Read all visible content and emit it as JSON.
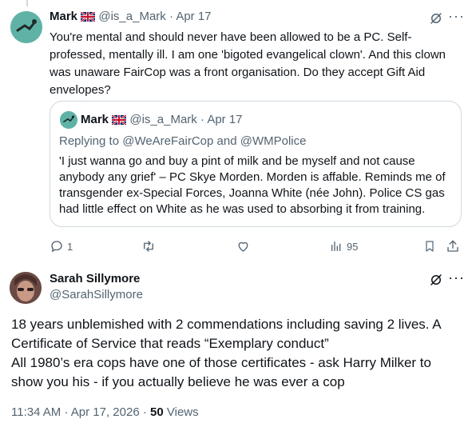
{
  "tweet1": {
    "name": "Mark",
    "handle": "@is_a_Mark",
    "sep": "·",
    "date": "Apr 17",
    "text_lines": [
      "You're mental and should never have been allowed to be a PC. Self-",
      "professed, mentally ill. I am one 'bigoted evangelical clown'. And this clown",
      "was unaware FairCop was a front organisation. Do they accept Gift Aid",
      "envelopes?"
    ]
  },
  "quote": {
    "name": "Mark",
    "handle": "@is_a_Mark",
    "sep": "·",
    "date": "Apr 17",
    "replying": "Replying to @WeAreFairCop and @WMPolice",
    "text_lines": [
      "'I just wanna go and buy a pint of milk and be myself and not cause",
      "anybody any grief' – PC Skye Morden. Morden is affable. Reminds me of",
      "transgender ex-Special Forces, Joanna White (née John). Police CS gas",
      "had little effect on White as he was used to absorbing it from training."
    ]
  },
  "actions": {
    "replies": "1",
    "views": "95",
    "icons": [
      "reply-icon",
      "retweet-icon",
      "like-icon",
      "views-icon",
      "bookmark-icon",
      "share-icon"
    ]
  },
  "tweet2": {
    "name": "Sarah Sillymore",
    "handle": "@SarahSillymore",
    "text_lines": [
      "18 years unblemished with 2 commendations including saving 2 lives. A",
      "Certificate of Service that reads “Exemplary conduct”",
      "All 1980’s era cops have one of those certificates - ask Harry Milker to",
      "show you his - if you actually believe he was ever a cop"
    ],
    "time": "11:34 AM",
    "sep1": "·",
    "date": "Apr 17, 2026",
    "sep2": "·",
    "views_count": "50",
    "views_label": "Views"
  },
  "colors": {
    "text": "#0f1419",
    "muted": "#536471",
    "border": "#cfd9de"
  }
}
